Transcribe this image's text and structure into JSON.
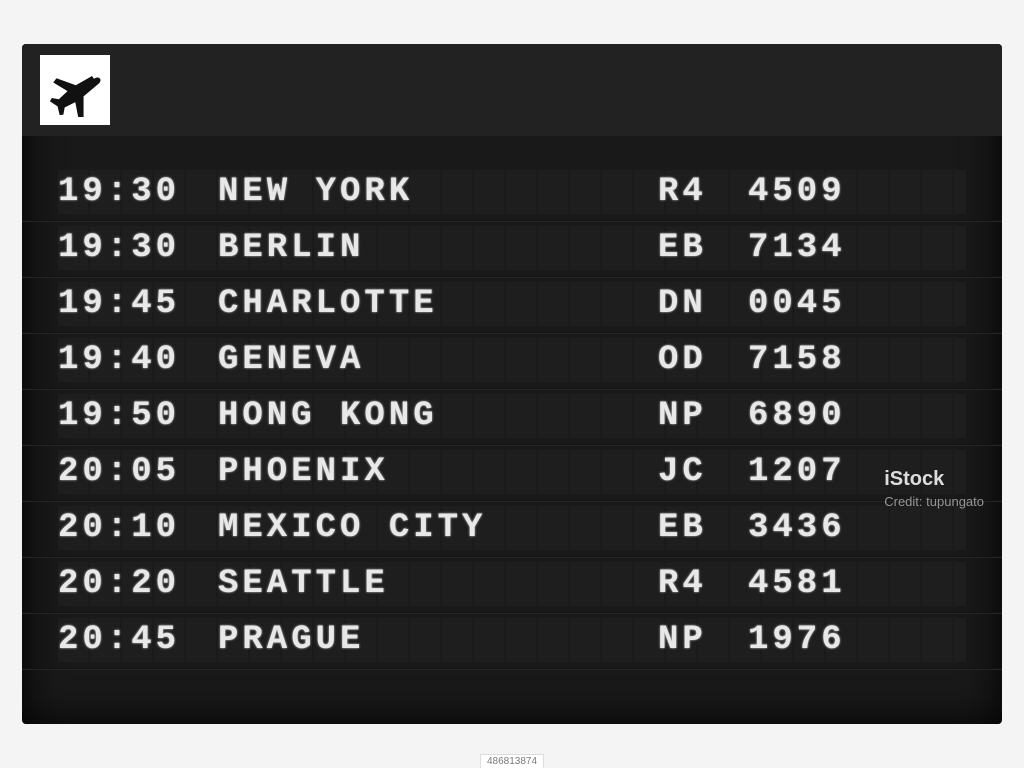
{
  "header": {
    "icon": "airplane-icon"
  },
  "flights": [
    {
      "time": "19:30",
      "destination": "NEW YORK",
      "code": "R4",
      "number": "4509"
    },
    {
      "time": "19:30",
      "destination": "BERLIN",
      "code": "EB",
      "number": "7134"
    },
    {
      "time": "19:45",
      "destination": "CHARLOTTE",
      "code": "DN",
      "number": "0045"
    },
    {
      "time": "19:40",
      "destination": "GENEVA",
      "code": "OD",
      "number": "7158"
    },
    {
      "time": "19:50",
      "destination": "HONG KONG",
      "code": "NP",
      "number": "6890"
    },
    {
      "time": "20:05",
      "destination": "PHOENIX",
      "code": "JC",
      "number": "1207"
    },
    {
      "time": "20:10",
      "destination": "MEXICO CITY",
      "code": "EB",
      "number": "3436"
    },
    {
      "time": "20:20",
      "destination": "SEATTLE",
      "code": "R4",
      "number": "4581"
    },
    {
      "time": "20:45",
      "destination": "PRAGUE",
      "code": "NP",
      "number": "1976"
    }
  ],
  "watermark": {
    "brand": "iStock",
    "credit_label": "Credit:",
    "credit_value": "tupungato"
  },
  "footer_id": "486813874"
}
